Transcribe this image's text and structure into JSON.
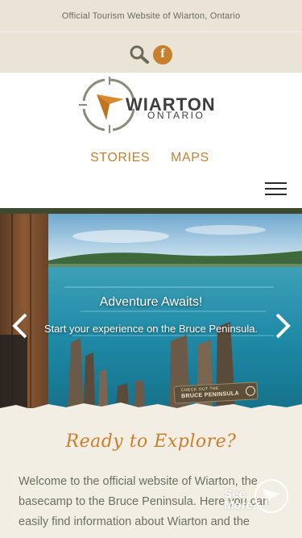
{
  "topbar": {
    "official_text": "Official Tourism Website of Wiarton, Ontario",
    "facebook_glyph": "f"
  },
  "logo": {
    "word": "WIARTON",
    "sub": "ONTARIO"
  },
  "nav": {
    "items": [
      {
        "label": "STORIES"
      },
      {
        "label": "MAPS"
      }
    ]
  },
  "hero": {
    "title": "Adventure Awaits!",
    "subtitle": "Start your experience on the Bruce Peninsula.",
    "badge_line1": "CHECK OUT THE",
    "badge_line2": "BRUCE PENINSULA"
  },
  "content": {
    "heading": "Ready to Explore?",
    "welcome": "Welcome to the official website of Wiarton, the basecamp to the Bruce Peninsula. Here you can easily find information about Wiarton and the"
  },
  "see_more": {
    "line1": "See",
    "line2": "More"
  },
  "colors": {
    "accent": "#c9802e",
    "topbar_bg": "#eae4d7",
    "page_bg": "#f3eee4",
    "body_text": "#6e6e60"
  },
  "icons": {
    "search": "search-icon",
    "facebook": "facebook-icon",
    "menu": "hamburger-menu-icon",
    "prev": "chevron-left-icon",
    "next": "chevron-right-icon",
    "compass": "compass-icon"
  }
}
